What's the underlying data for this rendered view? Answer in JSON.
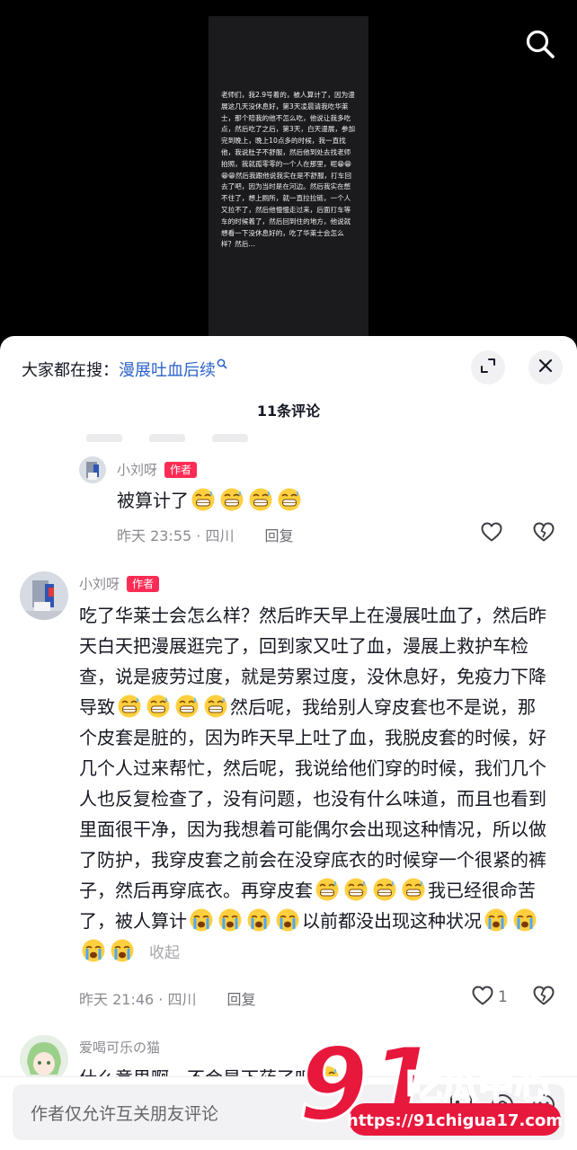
{
  "video": {
    "overlay_text": "老师们，我2.9号着的，被人算计了，因为漫展这几天没休息好，第3天凌晨请我吃华莱士，那个陪我的他不怎么吃，他说让我多吃点，然后吃了之后，第3天，白天漫展，参加完到晚上，晚上10点多的时候，我一直找他，我说肚子不舒服，然后他到处去找老师拍照，我就孤零零的一个人在那里，呢😁😁😁😁然后我跟他说我实在是不舒服，打车回去了吧，因为当时是在河边。然后我实在憋不住了，想上厕所，就一直拉拉链，一个人又拉不了，然后他慢慢走过来，后面打车等车的时候着了，然后回到住的地方，他说就想看一下没休息好的，吃了华莱士会怎么样？然后…"
  },
  "search_hint": {
    "prefix": "大家都在搜：",
    "keyword": "漫展吐血后续"
  },
  "comment_count": "11条评论",
  "reply_comment": {
    "author": "小刘呀",
    "tag": "作者",
    "text": "被算计了",
    "time": "昨天 23:55 · 四川",
    "reply_label": "回复"
  },
  "main_comment": {
    "author": "小刘呀",
    "tag": "作者",
    "text_part1": "吃了华莱士会怎么样？然后昨天早上在漫展吐血了，然后昨天白天把漫展逛完了，回到家又吐了血，漫展上救护车检查，说是疲劳过度，就是劳累过度，没休息好，免疫力下降导致",
    "text_part2": "然后呢，我给别人穿皮套也不是说，那个皮套是脏的，因为昨天早上吐了血，我脱皮套的时候，好几个人过来帮忙，然后呢，我说给他们穿的时候，我们几个人也反复检查了，没有问题，也没有什么味道，而且也看到里面很干净，因为我想着可能偶尔会出现这种情况，所以做了防护，我穿皮套之前会在没穿底衣的时候穿一个很紧的裤子，然后再穿底衣。再穿皮套",
    "text_part3": "我已经很命苦了，被人算计",
    "text_part4": "以前都没出现这种状况",
    "collapse_label": "收起",
    "time": "昨天 21:46 · 四川",
    "reply_label": "回复",
    "like_count": "1"
  },
  "third_comment": {
    "author": "爱喝可乐の猫",
    "text": "什么意思啊，不会是下药了吧"
  },
  "input": {
    "placeholder": "作者仅允许互关朋友评论"
  },
  "watermark": {
    "logo_number": "91",
    "logo_text": "吃瓜中心",
    "url": "https://91chigua17.com"
  },
  "colors": {
    "accent": "#fe2c55",
    "keyword_blue": "#2a62c9",
    "watermark_red": "#e8173c"
  }
}
